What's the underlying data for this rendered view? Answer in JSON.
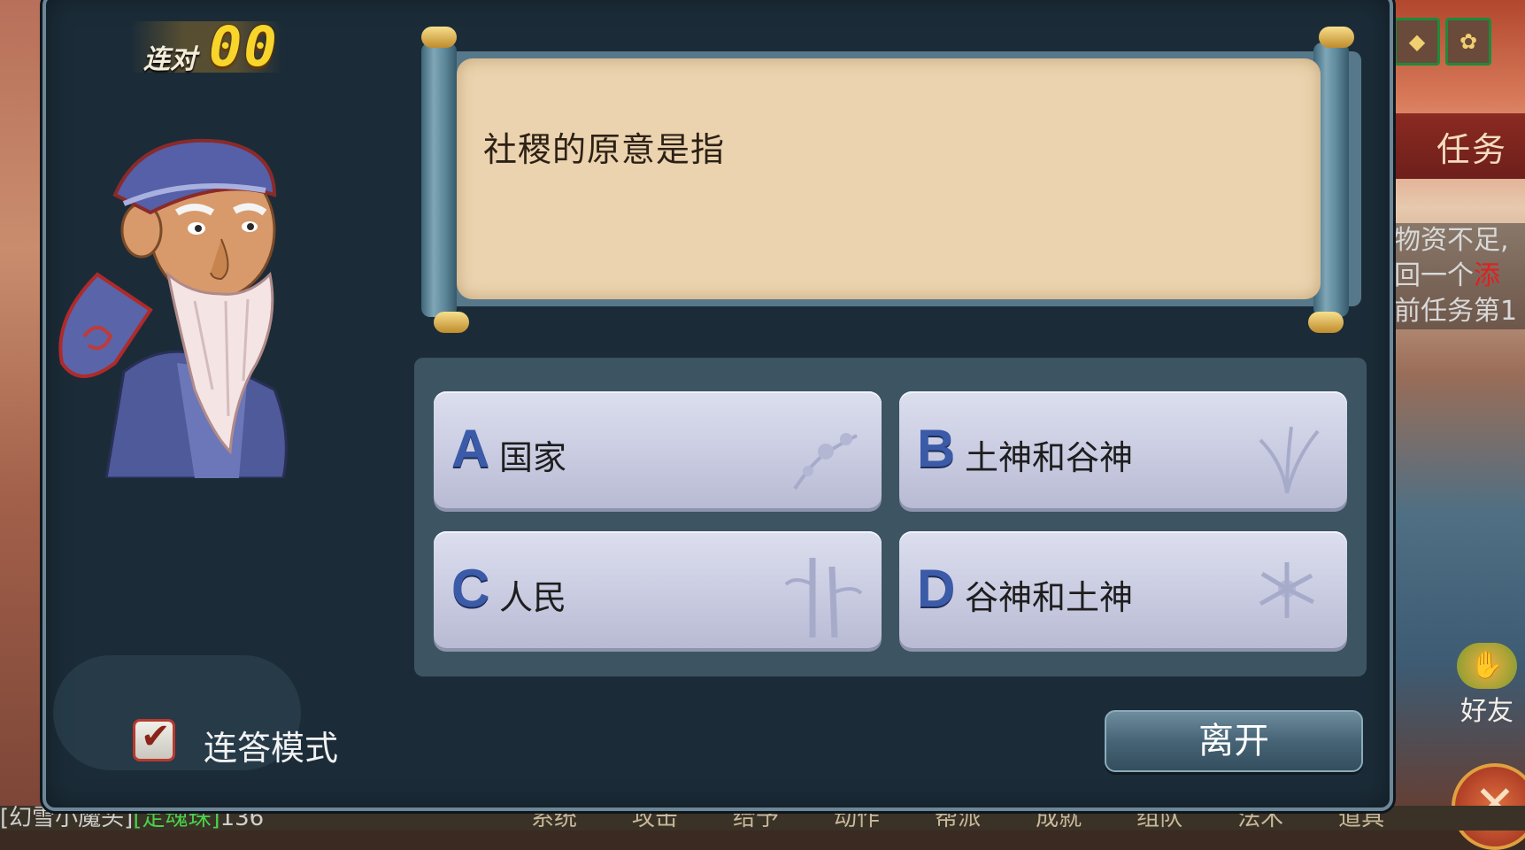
{
  "background": {
    "task_tab_label": "任务",
    "task_line_1": "物资不足,",
    "task_line_2a": "回一个",
    "task_line_2b": "添",
    "task_line_3": "前任务第1",
    "friend_label": "好友",
    "chat_line_prefix": "[幻雪小魔头]",
    "chat_line_item": "[定魂珠]",
    "chat_line_suffix": "136",
    "menu_items": [
      "系统",
      "攻击",
      "给予",
      "动作",
      "帮派",
      "成就",
      "组队",
      "法术",
      "道具"
    ]
  },
  "combo": {
    "label": "连对",
    "count": "00"
  },
  "question": {
    "text": "社稷的原意是指"
  },
  "answers": [
    {
      "letter": "A",
      "text": "国家"
    },
    {
      "letter": "B",
      "text": "土神和谷神"
    },
    {
      "letter": "C",
      "text": "人民"
    },
    {
      "letter": "D",
      "text": "谷神和土神"
    }
  ],
  "continuous_mode": {
    "label": "连答模式",
    "checked": true
  },
  "leave_button": {
    "label": "离开"
  },
  "colors": {
    "dialog_bg": "#1b2c38",
    "scroll_paper": "#ead3ae",
    "answer_letter": "#3b5ba8",
    "combo_number": "#f8d52a"
  }
}
